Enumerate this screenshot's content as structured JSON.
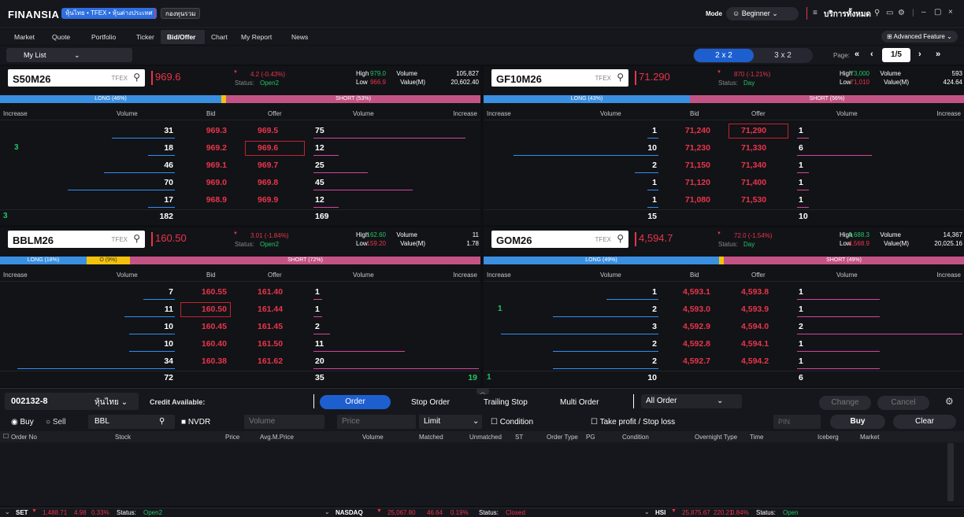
{
  "app": {
    "logo": "FINANSIA",
    "pills": [
      "หุ้นไทย • TFEX • หุ้นต่างประเทศ",
      "กองทุนรวม"
    ],
    "mode_label": "Mode",
    "mode_value": "Beginner",
    "service": "บริการทั้งหมด"
  },
  "menu": [
    "Market",
    "Quote",
    "Portfolio",
    "Ticker",
    "Bid/Offer",
    "Chart",
    "My Report",
    "News"
  ],
  "advanced": "Advanced Feature",
  "mylist": "My List",
  "layout": {
    "opt1": "2 x 2",
    "opt2": "3 x 2",
    "page_label": "Page:",
    "page": "1/5"
  },
  "colors": {
    "red": "#e8354a",
    "green": "#23c566",
    "blue": "#2f8ff0",
    "pink": "#d0469a",
    "long": "#3a8fe0",
    "short": "#c45385",
    "mid": "#f4c20d"
  },
  "headers": {
    "increase": "Increase",
    "volume": "Volume",
    "bid": "Bid",
    "offer": "Offer"
  },
  "panels": [
    {
      "symbol": "S50M26",
      "tag": "TFEX",
      "price": "969.6",
      "change": "4.2 (-0.43%)",
      "status_label": "Status:",
      "status": "Open2",
      "high_label": "High",
      "low_label": "Low",
      "high": "979.0",
      "low": "966.9",
      "vol_label": "Volume",
      "val_label": "Value(M)",
      "volume": "105,827",
      "value": "20,602.40",
      "long_label": "LONG (46%)",
      "short_label": "SHORT (53%)",
      "long_pct": 46,
      "mid_pct": 1,
      "rows": [
        {
          "inc_l": "",
          "bidvol": "31",
          "bid": "969.3",
          "offer": "969.5",
          "offvol": "75",
          "inc_r": ""
        },
        {
          "inc_l": "3",
          "bidvol": "18",
          "bid": "969.2",
          "offer": "969.6",
          "offvol": "12",
          "inc_r": "",
          "box": "offer"
        },
        {
          "inc_l": "",
          "bidvol": "46",
          "bid": "969.1",
          "offer": "969.7",
          "offvol": "25",
          "inc_r": ""
        },
        {
          "inc_l": "",
          "bidvol": "70",
          "bid": "969.0",
          "offer": "969.8",
          "offvol": "45",
          "inc_r": ""
        },
        {
          "inc_l": "",
          "bidvol": "17",
          "bid": "968.9",
          "offer": "969.9",
          "offvol": "12",
          "inc_r": ""
        }
      ],
      "bidbars": [
        0.4,
        0.17,
        0.45,
        0.68,
        0.17
      ],
      "offbars": [
        0.92,
        0.15,
        0.33,
        0.6,
        0.15
      ],
      "foot": {
        "inc_l": "3",
        "bidtot": "182",
        "offtot": "169",
        "inc_r": ""
      }
    },
    {
      "symbol": "GF10M26",
      "tag": "TFEX",
      "price": "71.290",
      "change": "870 (-1.21%)",
      "status_label": "Status:",
      "status": "Day",
      "high_label": "High",
      "low_label": "Low",
      "high": "73,000",
      "low": "71,010",
      "vol_label": "Volume",
      "val_label": "Value(M)",
      "volume": "593",
      "value": "424.64",
      "long_label": "LONG (43%)",
      "short_label": "SHORT (56%)",
      "long_pct": 43,
      "mid_pct": 0,
      "rows": [
        {
          "inc_l": "",
          "bidvol": "1",
          "bid": "71,240",
          "offer": "71,290",
          "offvol": "1",
          "inc_r": "",
          "box": "offer"
        },
        {
          "inc_l": "",
          "bidvol": "10",
          "bid": "71,230",
          "offer": "71,330",
          "offvol": "6",
          "inc_r": ""
        },
        {
          "inc_l": "",
          "bidvol": "2",
          "bid": "71,150",
          "offer": "71,340",
          "offvol": "1",
          "inc_r": ""
        },
        {
          "inc_l": "",
          "bidvol": "1",
          "bid": "71,120",
          "offer": "71,400",
          "offvol": "1",
          "inc_r": ""
        },
        {
          "inc_l": "",
          "bidvol": "1",
          "bid": "71,080",
          "offer": "71,530",
          "offvol": "1",
          "inc_r": ""
        }
      ],
      "bidbars": [
        0.07,
        0.92,
        0.15,
        0.07,
        0.07
      ],
      "offbars": [
        0.07,
        0.45,
        0.07,
        0.07,
        0.07
      ],
      "foot": {
        "inc_l": "",
        "bidtot": "15",
        "offtot": "10",
        "inc_r": ""
      }
    },
    {
      "symbol": "BBLM26",
      "tag": "TFEX",
      "price": "160.50",
      "change": "3.01 (-1.84%)",
      "status_label": "Status:",
      "status": "Open2",
      "high_label": "High",
      "low_label": "Low",
      "high": "162.60",
      "low": "159.20",
      "vol_label": "Volume",
      "val_label": "Value(M)",
      "volume": "11",
      "value": "1.78",
      "long_label": "LONG (18%)",
      "mid_label": "O (9%)",
      "short_label": "SHORT (72%)",
      "long_pct": 18,
      "mid_pct": 9,
      "rows": [
        {
          "inc_l": "",
          "bidvol": "7",
          "bid": "160.55",
          "offer": "161.40",
          "offvol": "1",
          "inc_r": ""
        },
        {
          "inc_l": "",
          "bidvol": "11",
          "bid": "160.50",
          "offer": "161.44",
          "offvol": "1",
          "inc_r": "",
          "box": "bid"
        },
        {
          "inc_l": "",
          "bidvol": "10",
          "bid": "160.45",
          "offer": "161.45",
          "offvol": "2",
          "inc_r": ""
        },
        {
          "inc_l": "",
          "bidvol": "10",
          "bid": "160.40",
          "offer": "161.50",
          "offvol": "11",
          "inc_r": ""
        },
        {
          "inc_l": "",
          "bidvol": "34",
          "bid": "160.38",
          "offer": "161.62",
          "offvol": "20",
          "inc_r": ""
        }
      ],
      "bidbars": [
        0.2,
        0.32,
        0.29,
        0.29,
        1.0
      ],
      "offbars": [
        0.05,
        0.05,
        0.1,
        0.55,
        1.0
      ],
      "foot": {
        "inc_l": "",
        "bidtot": "72",
        "offtot": "35",
        "inc_r": "19"
      }
    },
    {
      "symbol": "GOM26",
      "tag": "TFEX",
      "price": "4,594.7",
      "change": "72.0 (-1.54%)",
      "status_label": "Status:",
      "status": "Day",
      "high_label": "High",
      "low_label": "Low",
      "high": "4,688.3",
      "low": "4,568.9",
      "vol_label": "Volume",
      "val_label": "Value(M)",
      "volume": "14,367",
      "value": "20,025.16",
      "long_label": "LONG (49%)",
      "short_label": "SHORT (49%)",
      "long_pct": 49,
      "mid_pct": 1,
      "rows": [
        {
          "inc_l": "",
          "bidvol": "1",
          "bid": "4,593.1",
          "offer": "4,593.8",
          "offvol": "1",
          "inc_r": ""
        },
        {
          "inc_l": "1",
          "bidvol": "2",
          "bid": "4,593.0",
          "offer": "4,593.9",
          "offvol": "1",
          "inc_r": ""
        },
        {
          "inc_l": "",
          "bidvol": "3",
          "bid": "4,592.9",
          "offer": "4,594.0",
          "offvol": "2",
          "inc_r": ""
        },
        {
          "inc_l": "",
          "bidvol": "2",
          "bid": "4,592.8",
          "offer": "4,594.1",
          "offvol": "1",
          "inc_r": ""
        },
        {
          "inc_l": "",
          "bidvol": "2",
          "bid": "4,592.7",
          "offer": "4,594.2",
          "offvol": "1",
          "inc_r": ""
        }
      ],
      "bidbars": [
        0.33,
        0.67,
        1.0,
        0.67,
        0.67
      ],
      "offbars": [
        0.5,
        0.5,
        1.0,
        0.5,
        0.5
      ],
      "foot": {
        "inc_l": "1",
        "bidtot": "10",
        "offtot": "6",
        "inc_r": ""
      }
    }
  ],
  "order": {
    "account": "002132-8",
    "market": "หุ้นไทย",
    "credit": "Credit Available:",
    "tabs": [
      "Order",
      "Stop Order",
      "Trailing Stop",
      "Multi Order"
    ],
    "filter": "All Order",
    "change": "Change",
    "cancel": "Cancel",
    "buy": "Buy",
    "sell": "Sell",
    "stock": "BBL",
    "nvdr": "NVDR",
    "volume_ph": "Volume",
    "price_ph": "Price",
    "type": "Limit",
    "condition": "Condition",
    "tp": "Take profit / Stop loss",
    "pin": "PIN",
    "buy_btn": "Buy",
    "clear_btn": "Clear",
    "cols": [
      "Order No",
      "Stock",
      "Price",
      "Avg.M.Price",
      "Volume",
      "Matched",
      "Unmatched",
      "ST",
      "Order Type",
      "PG",
      "Condition",
      "Overnight Type",
      "Time",
      "Iceberg",
      "Market"
    ]
  },
  "ticker": [
    {
      "name": "SET",
      "value": "1,488.71",
      "chg": "4.98",
      "pct": "0.33%",
      "status_label": "Status:",
      "status": "Open2"
    },
    {
      "name": "NASDAQ",
      "value": "25,067.80",
      "chg": "46.64",
      "pct": "0.19%",
      "status_label": "Status:",
      "status": "Closed"
    },
    {
      "name": "HSI",
      "value": "25,875.67",
      "chg": "220.21",
      "pct": "0.84%",
      "status_label": "Status:",
      "status": "Open"
    }
  ]
}
